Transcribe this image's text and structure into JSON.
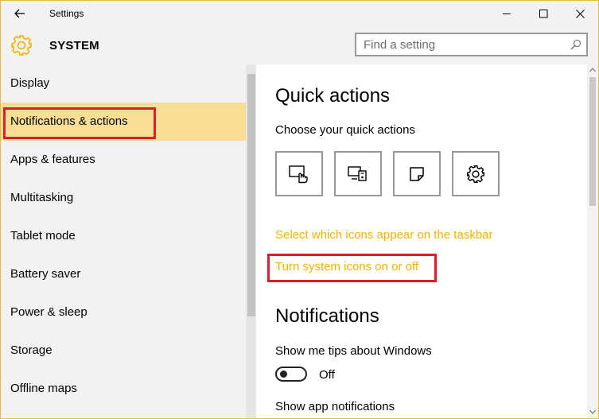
{
  "window": {
    "title": "Settings"
  },
  "header": {
    "section_title": "SYSTEM",
    "search": {
      "placeholder": "Find a setting"
    }
  },
  "sidebar": {
    "items": [
      {
        "label": "Display"
      },
      {
        "label": "Notifications & actions",
        "selected": true
      },
      {
        "label": "Apps & features"
      },
      {
        "label": "Multitasking"
      },
      {
        "label": "Tablet mode"
      },
      {
        "label": "Battery saver"
      },
      {
        "label": "Power & sleep"
      },
      {
        "label": "Storage"
      },
      {
        "label": "Offline maps"
      }
    ]
  },
  "main": {
    "quick_actions_title": "Quick actions",
    "quick_actions_subtitle": "Choose your quick actions",
    "quick_action_icons": [
      "tablet-mode-icon",
      "project-icon",
      "note-icon",
      "all-settings-icon"
    ],
    "link_taskbar_icons": "Select which icons appear on the taskbar",
    "link_system_icons": "Turn system icons on or off",
    "notifications_title": "Notifications",
    "tips_label": "Show me tips about Windows",
    "tips_state": "Off",
    "app_notifications_label": "Show app notifications"
  },
  "colors": {
    "accent": "#f0b300",
    "selection": "#f8dd94",
    "highlight_box": "#e21b2a"
  }
}
